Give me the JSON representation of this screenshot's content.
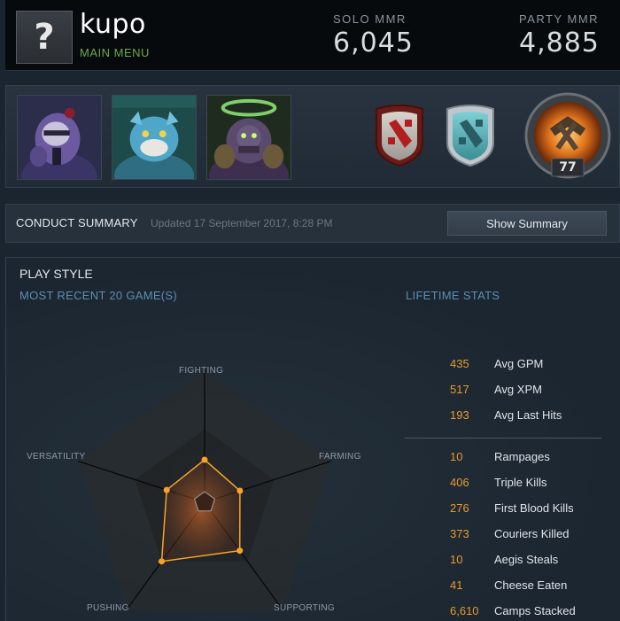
{
  "header": {
    "avatar_glyph": "?",
    "player_name": "kupo",
    "subtitle": "MAIN MENU",
    "solo_mmr_label": "SOLO MMR",
    "solo_mmr_value": "6,045",
    "party_mmr_label": "PARTY MMR",
    "party_mmr_value": "4,885"
  },
  "heroes": [
    {
      "icon": "hero-portrait-purple-icon"
    },
    {
      "icon": "hero-portrait-blue-beast-icon"
    },
    {
      "icon": "hero-portrait-dark-druid-icon"
    }
  ],
  "badges": {
    "red_badge_icon": "dota-logo-red-shield-icon",
    "teal_badge_icon": "dota-logo-teal-shield-icon",
    "level_icon": "battle-level-medallion-icon",
    "level": "77"
  },
  "conduct": {
    "title": "CONDUCT SUMMARY",
    "updated": "Updated 17 September 2017, 8:28 PM",
    "button": "Show Summary"
  },
  "playstyle": {
    "title": "PLAY STYLE",
    "recent_label": "MOST RECENT 20 GAME(S)",
    "lifetime_label": "LIFETIME STATS",
    "axes": [
      "FIGHTING",
      "FARMING",
      "SUPPORTING",
      "PUSHING",
      "VERSATILITY"
    ],
    "values": [
      0.32,
      0.28,
      0.45,
      0.55,
      0.3
    ]
  },
  "lifetime_stats": {
    "averages": [
      {
        "value": "435",
        "label": "Avg GPM"
      },
      {
        "value": "517",
        "label": "Avg XPM"
      },
      {
        "value": "193",
        "label": "Avg Last Hits"
      }
    ],
    "totals": [
      {
        "value": "10",
        "label": "Rampages"
      },
      {
        "value": "406",
        "label": "Triple Kills"
      },
      {
        "value": "276",
        "label": "First Blood Kills"
      },
      {
        "value": "373",
        "label": "Couriers Killed"
      },
      {
        "value": "10",
        "label": "Aegis Steals"
      },
      {
        "value": "41",
        "label": "Cheese Eaten"
      },
      {
        "value": "6,610",
        "label": "Camps Stacked"
      }
    ]
  },
  "colors": {
    "accent_orange": "#e79a2e",
    "label_blue": "#5b8fb3",
    "name_green": "#6fa84a"
  }
}
